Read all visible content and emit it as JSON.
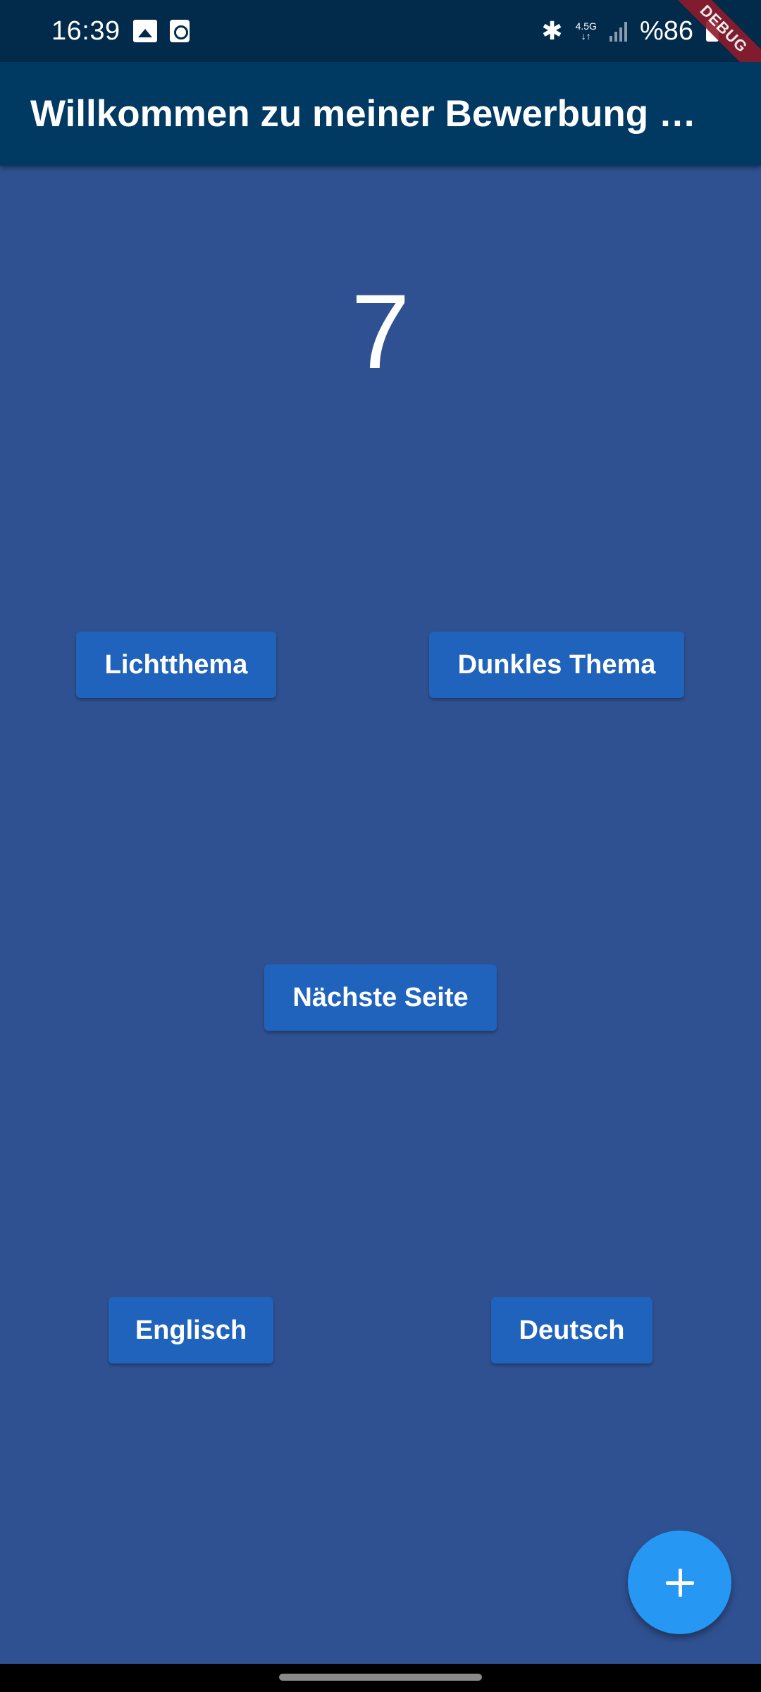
{
  "status_bar": {
    "time": "16:39",
    "network": "4.5G",
    "battery": "%86",
    "icons": [
      "gallery-icon",
      "clock-icon",
      "bluetooth-icon",
      "network-icon",
      "signal-icon",
      "battery-charging-icon"
    ]
  },
  "debug_banner": "DEBUG",
  "app_bar": {
    "title": "Willkommen zu meiner Bewerbung …"
  },
  "counter": {
    "value": "7"
  },
  "buttons": {
    "light_theme": "Lichtthema",
    "dark_theme": "Dunkles Thema",
    "next_page": "Nächste Seite",
    "english": "Englisch",
    "german": "Deutsch"
  },
  "fab": {
    "icon": "plus-icon"
  },
  "colors": {
    "background": "#305191",
    "app_bar": "#003961",
    "status_bar": "#022a4a",
    "button": "#1f63bd",
    "fab": "#2698f3"
  }
}
